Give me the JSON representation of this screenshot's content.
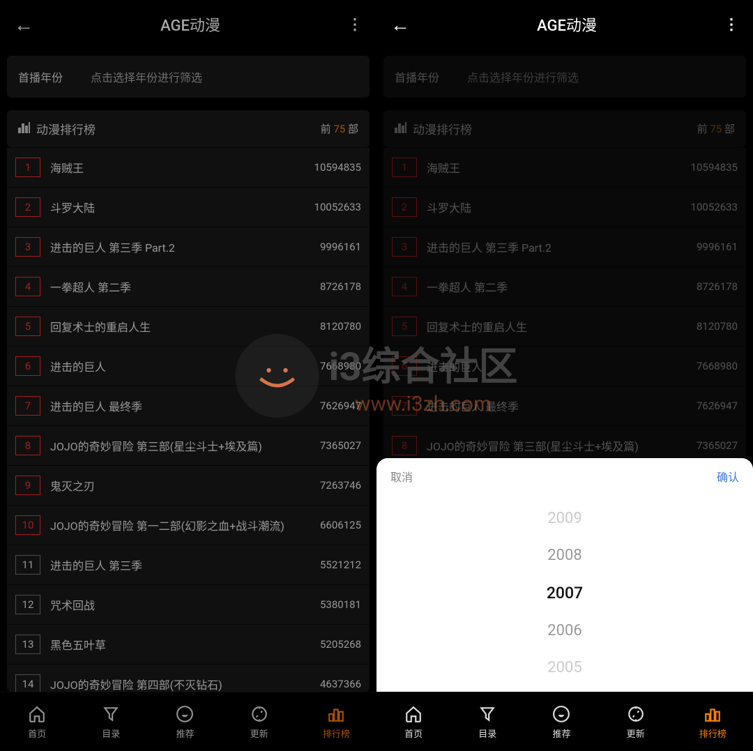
{
  "header": {
    "title": "AGE动漫"
  },
  "filter": {
    "label": "首播年份",
    "hint": "点击选择年份进行筛选"
  },
  "rank_section": {
    "title": "动漫排行榜",
    "prefix": "前",
    "count": "75",
    "suffix": "部"
  },
  "anime_list": [
    {
      "rank": "1",
      "name": "海贼王",
      "views": "10594835",
      "top": true
    },
    {
      "rank": "2",
      "name": "斗罗大陆",
      "views": "10052633",
      "top": true
    },
    {
      "rank": "3",
      "name": "进击的巨人 第三季 Part.2",
      "views": "9996161",
      "top": true
    },
    {
      "rank": "4",
      "name": "一拳超人 第二季",
      "views": "8726178",
      "top": true
    },
    {
      "rank": "5",
      "name": "回复术士的重启人生",
      "views": "8120780",
      "top": true
    },
    {
      "rank": "6",
      "name": "进击的巨人",
      "views": "7668980",
      "top": true
    },
    {
      "rank": "7",
      "name": "进击的巨人 最终季",
      "views": "7626947",
      "top": true
    },
    {
      "rank": "8",
      "name": "JOJO的奇妙冒险 第三部(星尘斗士+埃及篇)",
      "views": "7365027",
      "top": true
    },
    {
      "rank": "9",
      "name": "鬼灭之刃",
      "views": "7263746",
      "top": true
    },
    {
      "rank": "10",
      "name": "JOJO的奇妙冒险 第一二部(幻影之血+战斗潮流)",
      "views": "6606125",
      "top": true
    },
    {
      "rank": "11",
      "name": "进击的巨人 第三季",
      "views": "5521212",
      "top": false
    },
    {
      "rank": "12",
      "name": "咒术回战",
      "views": "5380181",
      "top": false
    },
    {
      "rank": "13",
      "name": "黑色五叶草",
      "views": "5205268",
      "top": false
    },
    {
      "rank": "14",
      "name": "JOJO的奇妙冒险 第四部(不灭钻石)",
      "views": "4637366",
      "top": false
    }
  ],
  "anime_list_right": [
    {
      "rank": "1",
      "name": "海贼王",
      "views": "10594835",
      "top": true
    },
    {
      "rank": "2",
      "name": "斗罗大陆",
      "views": "10052633",
      "top": true
    },
    {
      "rank": "3",
      "name": "进击的巨人 第三季 Part.2",
      "views": "9996161",
      "top": true
    },
    {
      "rank": "4",
      "name": "一拳超人 第二季",
      "views": "8726178",
      "top": true
    },
    {
      "rank": "5",
      "name": "回复术士的重启人生",
      "views": "8120780",
      "top": true
    },
    {
      "rank": "6",
      "name": "进击的巨人",
      "views": "7668980",
      "top": true
    },
    {
      "rank": "7",
      "name": "进击的巨人 最终季",
      "views": "7626947",
      "top": true
    },
    {
      "rank": "8",
      "name": "JOJO的奇妙冒险 第三部(星尘斗士+埃及篇)",
      "views": "7365027",
      "top": true
    }
  ],
  "picker": {
    "cancel": "取消",
    "confirm": "确认",
    "options": [
      "2009",
      "2008",
      "2007",
      "2006",
      "2005"
    ],
    "selected_index": 2
  },
  "nav": [
    {
      "label": "首页",
      "active": false
    },
    {
      "label": "目录",
      "active": false
    },
    {
      "label": "推荐",
      "active": false
    },
    {
      "label": "更新",
      "active": false
    },
    {
      "label": "排行榜",
      "active": true
    }
  ],
  "watermark": {
    "text1": "i3综合社区",
    "text2": "www.i3zh.com"
  }
}
